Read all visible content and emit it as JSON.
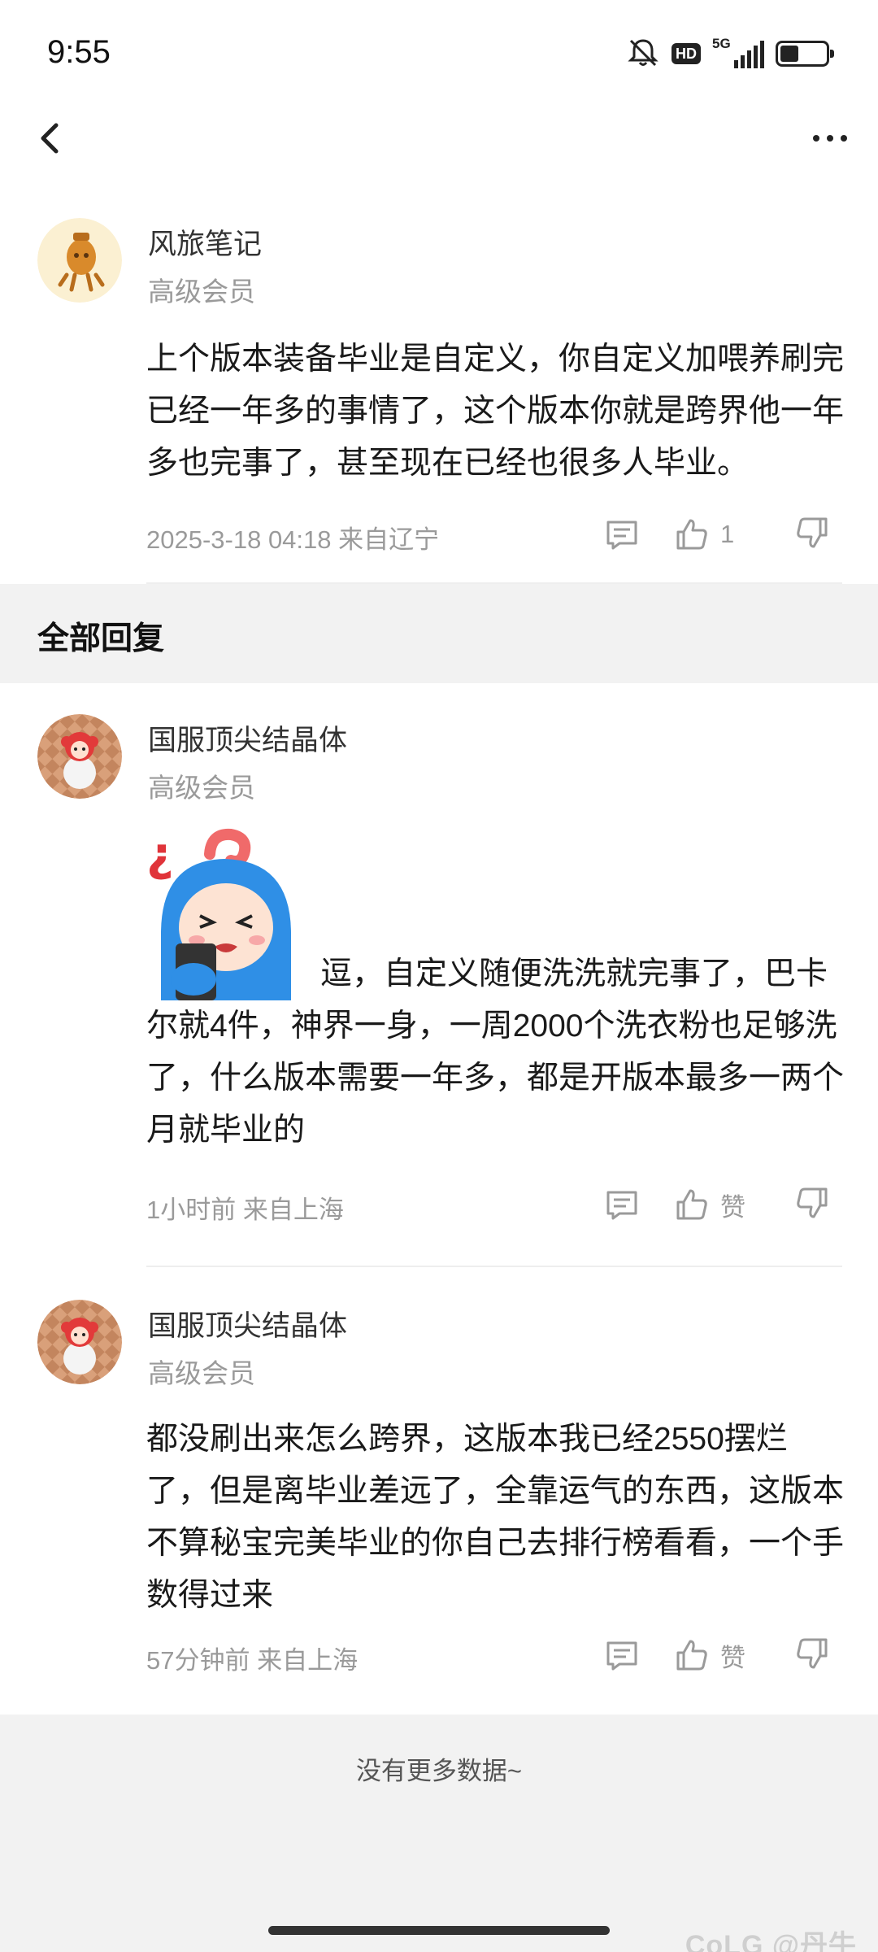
{
  "status_bar": {
    "time": "9:55",
    "icons": [
      "mute-icon",
      "hd-icon",
      "signal-5g-icon",
      "battery-icon"
    ],
    "hd_label": "HD",
    "network_label": "5G",
    "battery_percent": 40
  },
  "nav": {
    "back_icon": "chevron-left-icon",
    "more_icon": "more-horizontal-icon"
  },
  "main_comment": {
    "author": "风旅笔记",
    "level": "高级会员",
    "text": "上个版本装备毕业是自定义，你自定义加喂养刷完已经一年多的事情了，这个版本你就是跨界他一年多也完事了，甚至现在已经也很多人毕业。",
    "time_location": "2025-3-18 04:18  来自辽宁",
    "like_count": "1"
  },
  "section": {
    "title": "全部回复"
  },
  "replies": [
    {
      "author": "国服顶尖结晶体",
      "level": "高级会员",
      "sticker": "confused-phone-sticker",
      "text": "逗，自定义随便洗洗就完事了，巴卡尔就4件，神界一身，一周2000个洗衣粉也足够洗了，什么版本需要一年多，都是开版本最多一两个月就毕业的",
      "time_location": "1小时前  来自上海",
      "like_label": "赞"
    },
    {
      "author": "国服顶尖结晶体",
      "level": "高级会员",
      "text": "都没刷出来怎么跨界，这版本我已经2550摆烂了，但是离毕业差远了，全靠运气的东西，这版本不算秘宝完美毕业的你自己去排行榜看看，一个手数得过来",
      "time_location": "57分钟前  来自上海",
      "like_label": "赞"
    }
  ],
  "footer": {
    "no_more": "没有更多数据~",
    "watermark": "CoLG @丹牛"
  },
  "colors": {
    "text_primary": "#1a1a1a",
    "text_secondary": "#9a9a9a",
    "section_bg": "#f2f2f2"
  }
}
